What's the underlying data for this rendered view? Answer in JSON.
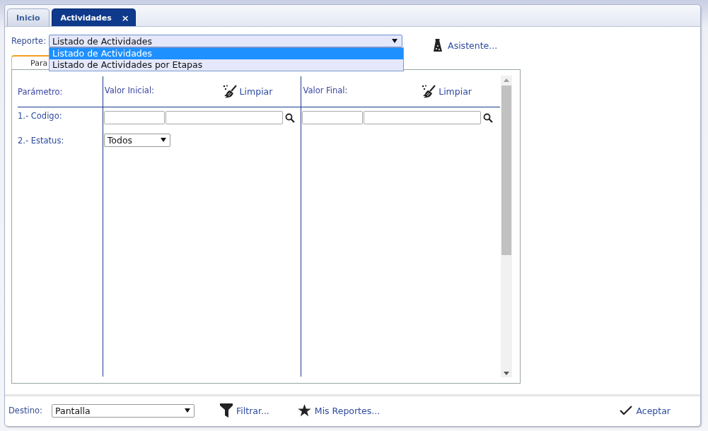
{
  "tabs": [
    {
      "label": "Inicio",
      "selected": false
    },
    {
      "label": "Actividades",
      "selected": true,
      "close": "×"
    }
  ],
  "report": {
    "label": "Reporte:",
    "value": "Listado de Actividades",
    "expanded": true,
    "options": [
      {
        "label": "Listado de Actividades",
        "selected": true
      },
      {
        "label": "Listado de Actividades por Etapas",
        "selected": false
      }
    ]
  },
  "assistant": {
    "label": "Asistente..."
  },
  "panel_tabs": [
    {
      "label": "Para",
      "selected": true
    }
  ],
  "parameters": {
    "columns": [
      {
        "heading": "Parámetro:"
      },
      {
        "heading": "Valor Inicial:",
        "action": "Limpiar"
      },
      {
        "heading": "Valor Final:",
        "action": "Limpiar"
      }
    ],
    "rows": [
      {
        "label": "1.- Codigo:",
        "kind": "lookup"
      },
      {
        "label": "2.- Estatus:",
        "kind": "select",
        "value": "Todos"
      }
    ]
  },
  "footer": {
    "destination_label": "Destino:",
    "destination_value": "Pantalla",
    "buttons": [
      {
        "label": "Filtrar...",
        "kind": "filter"
      },
      {
        "label": "Mis Reportes...",
        "kind": "star"
      },
      {
        "label": "Aceptar",
        "kind": "accept"
      }
    ]
  }
}
